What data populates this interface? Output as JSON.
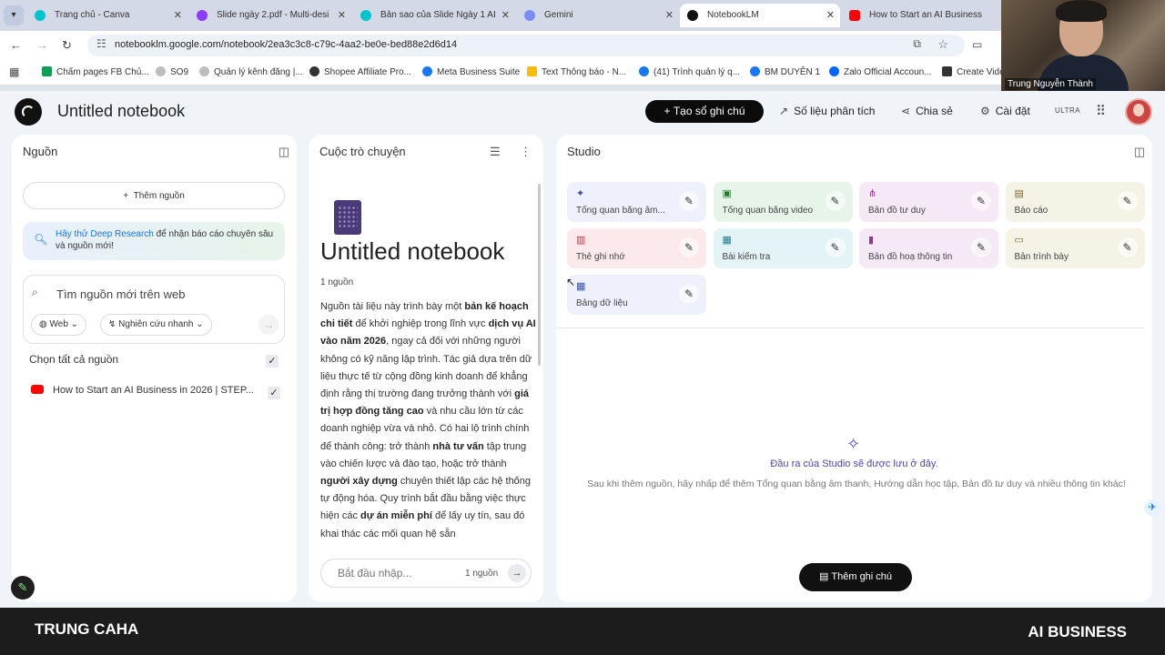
{
  "browser": {
    "tabs": [
      {
        "title": "Trang chủ - Canva",
        "color": "#00c4cc"
      },
      {
        "title": "Slide ngày 2.pdf - Multi-desi",
        "color": "#8b3dff"
      },
      {
        "title": "Bản sao của Slide Ngày 1 AI",
        "color": "#00c4cc"
      },
      {
        "title": "Gemini",
        "color": "#7b8cff"
      },
      {
        "title": "NotebookLM",
        "color": "#111111"
      },
      {
        "title": "How to Start an AI Business",
        "color": "#ff0000"
      }
    ],
    "url": "notebooklm.google.com/notebook/2ea3c3c8-c79c-4aa2-be0e-bed88e2d6d14",
    "bookmarks": [
      {
        "label": "Chấm pages FB Chủ...",
        "color": "#0f9d58"
      },
      {
        "label": "SO9",
        "color": "#888888"
      },
      {
        "label": "Quản lý kênh đăng |...",
        "color": "#888888"
      },
      {
        "label": "Shopee Affiliate Pro...",
        "color": "#333333"
      },
      {
        "label": "Meta Business Suite",
        "color": "#1877f2"
      },
      {
        "label": "Text Thông báo - N...",
        "color": "#fbbc04"
      },
      {
        "label": "(41) Trình quản lý q...",
        "color": "#1877f2"
      },
      {
        "label": "BM DUYÊN 1",
        "color": "#1877f2"
      },
      {
        "label": "Zalo Official Accoun...",
        "color": "#0068ff"
      },
      {
        "label": "Create Vide",
        "color": "#333333"
      }
    ]
  },
  "webcam": {
    "name": "Trung Nguyễn Thành"
  },
  "app": {
    "notebook_title": "Untitled notebook",
    "create_note": "Tạo sổ ghi chú",
    "analytics": "Số liệu phân tích",
    "share": "Chia sẻ",
    "settings": "Cài đặt",
    "plan": "ULTRA"
  },
  "sources": {
    "title": "Nguồn",
    "add_button": "Thêm nguồn",
    "deep_research_link": "Hãy thử Deep Research",
    "deep_research_text": " để nhận báo cáo chuyên sâu và nguồn mới!",
    "search_placeholder": "Tìm nguồn mới trên web",
    "chip_web": "Web",
    "chip_research": "Nghiên cứu nhanh",
    "select_all": "Chọn tất cả nguồn",
    "items": [
      {
        "title": "How to Start an AI Business in 2026 | STEP..."
      }
    ]
  },
  "chat": {
    "title": "Cuộc trò chuyện",
    "notebook_title": "Untitled notebook",
    "source_count": "1 nguồn",
    "summary": [
      {
        "t": "Nguồn tài liệu này trình bày một ",
        "b": false
      },
      {
        "t": "bản kế hoạch chi tiết",
        "b": true
      },
      {
        "t": " để khởi nghiệp trong lĩnh vực ",
        "b": false
      },
      {
        "t": "dịch vụ AI vào năm 2026",
        "b": true
      },
      {
        "t": ", ngay cả đối với những người không có kỹ năng lập trình. Tác giả dựa trên dữ liệu thực tế từ cộng đồng kinh doanh để khẳng định rằng thị trường đang trưởng thành với ",
        "b": false
      },
      {
        "t": "giá trị hợp đồng tăng cao",
        "b": true
      },
      {
        "t": " và nhu cầu lớn từ các doanh nghiệp vừa và nhỏ. Có hai lộ trình chính để thành công: trở thành ",
        "b": false
      },
      {
        "t": "nhà tư vấn",
        "b": true
      },
      {
        "t": " tập trung vào chiến lược và đào tạo, hoặc trở thành ",
        "b": false
      },
      {
        "t": "người xây dựng",
        "b": true
      },
      {
        "t": " chuyên thiết lập các hệ thống tự động hóa. Quy trình bắt đầu bằng việc thực hiện các ",
        "b": false
      },
      {
        "t": "dự án miễn phí",
        "b": true
      },
      {
        "t": " để lấy uy tín, sau đó khai thác các mối quan hệ sẵn",
        "b": false
      }
    ],
    "input_placeholder": "Bắt đầu nhập...",
    "input_count": "1 nguồn"
  },
  "studio": {
    "title": "Studio",
    "tiles": [
      {
        "label": "Tổng quan bằng âm...",
        "icon": "audio-sparkle-icon",
        "glyph": "✦",
        "bg": "#eef1fb",
        "fg": "#3b4fa8"
      },
      {
        "label": "Tổng quan bằng video",
        "icon": "video-icon",
        "glyph": "▣",
        "bg": "#e6f4ea",
        "fg": "#2e7d32"
      },
      {
        "label": "Bản đồ tư duy",
        "icon": "mind-map-icon",
        "glyph": "⋔",
        "bg": "#f6e9f6",
        "fg": "#8e3b8e"
      },
      {
        "label": "Báo cáo",
        "icon": "report-icon",
        "glyph": "▤",
        "bg": "#f5f3e6",
        "fg": "#7a6a2e"
      },
      {
        "label": "Thẻ ghi nhớ",
        "icon": "flashcards-icon",
        "glyph": "▥",
        "bg": "#fbe9ec",
        "fg": "#b0344b"
      },
      {
        "label": "Bài kiểm tra",
        "icon": "quiz-icon",
        "glyph": "▦",
        "bg": "#e3f3f6",
        "fg": "#1f7a8c"
      },
      {
        "label": "Bản đồ hoạ thông tin",
        "icon": "infographic-icon",
        "glyph": "▮",
        "bg": "#f6e9f6",
        "fg": "#8e3b8e"
      },
      {
        "label": "Bản trình bày",
        "icon": "slides-icon",
        "glyph": "▭",
        "bg": "#f5f3e6",
        "fg": "#7a6a2e"
      },
      {
        "label": "Bảng dữ liệu",
        "icon": "data-table-icon",
        "glyph": "▦",
        "bg": "#eef1fb",
        "fg": "#3b4fa8"
      }
    ],
    "empty_title": "Đầu ra của Studio sẽ được lưu ở đây.",
    "empty_text": "Sau khi thêm nguồn, hãy nhấp để thêm Tổng quan bằng âm thanh, Hướng dẫn học tập, Bản đồ tư duy và nhiều thông tin khác!",
    "add_note": "Thêm ghi chú"
  },
  "overlay": {
    "left": "TRUNG CAHA",
    "right": "AI BUSINESS"
  }
}
